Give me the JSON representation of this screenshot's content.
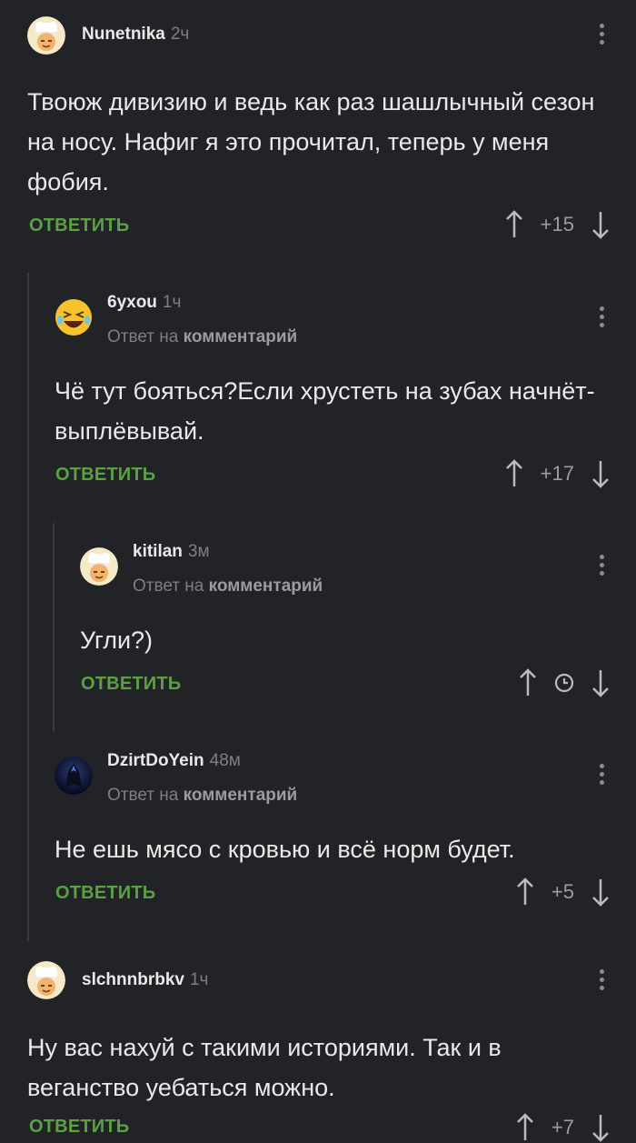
{
  "comments": [
    {
      "author": "Nunetnika",
      "time": "2ч",
      "text": "Твоюж дивизию и ведь как раз шашлычный сезон на носу. Нафиг я это прочитал, теперь у меня фобия.",
      "reply_label": "ОТВЕТИТЬ",
      "score": "+15",
      "avatar_icon": "chef-avatar-icon"
    },
    {
      "author": "6yxou",
      "time": "1ч",
      "reply_prefix": "Ответ на",
      "reply_link": "комментарий",
      "text": "Чё тут бояться?Если хрустеть на зубах начнёт-выплёвывай.",
      "reply_label": "ОТВЕТИТЬ",
      "score": "+17",
      "avatar_icon": "laughing-emoji-avatar-icon"
    },
    {
      "author": "kitilan",
      "time": "3м",
      "reply_prefix": "Ответ на",
      "reply_link": "комментарий",
      "text": "Угли?)",
      "reply_label": "ОТВЕТИТЬ",
      "score_icon": "clock-icon",
      "avatar_icon": "chef-avatar-icon"
    },
    {
      "author": "DzirtDoYein",
      "time": "48м",
      "reply_prefix": "Ответ на",
      "reply_link": "комментарий",
      "text": "Не ешь мясо с кровью и всё норм будет.",
      "reply_label": "ОТВЕТИТЬ",
      "score": "+5",
      "avatar_icon": "dark-figure-avatar-icon"
    },
    {
      "author": "slchnnbrbkv",
      "time": "1ч",
      "text": "Ну вас нахуй с такими историями. Так и в веганство уебаться можно.",
      "reply_label": "ОТВЕТИТЬ",
      "score": "+7",
      "avatar_icon": "chef-avatar-icon"
    }
  ],
  "colors": {
    "background": "#222326",
    "accent_green": "#5aa144",
    "muted_text": "#7d7f83",
    "thread_line": "#3a3b3e"
  }
}
